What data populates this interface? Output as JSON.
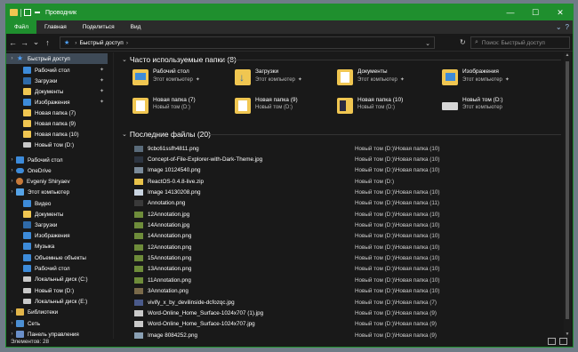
{
  "window": {
    "title": "Проводник"
  },
  "titlebar": {
    "minimize": "—",
    "maximize": "☐",
    "close": "✕"
  },
  "ribbon": {
    "tabs": [
      "Файл",
      "Главная",
      "Поделиться",
      "Вид"
    ]
  },
  "address": {
    "back": "←",
    "forward": "→",
    "recent": "⌄",
    "up": "↑",
    "path": "Быстрый доступ",
    "refresh": "↻",
    "search_placeholder": "Поиск: Быстрый доступ"
  },
  "nav": [
    {
      "label": "Быстрый доступ",
      "icon": "star-icon",
      "type": "star",
      "pinned": false,
      "selected": true
    },
    {
      "label": "Рабочий стол",
      "icon": "desktop-icon",
      "type": "blue",
      "pinned": true
    },
    {
      "label": "Загрузки",
      "icon": "downloads-icon",
      "type": "darkblue",
      "pinned": true
    },
    {
      "label": "Документы",
      "icon": "documents-icon",
      "type": "folder",
      "pinned": true
    },
    {
      "label": "Изображения",
      "icon": "pictures-icon",
      "type": "blue",
      "pinned": true
    },
    {
      "label": "Новая папка (7)",
      "icon": "folder-icon",
      "type": "folder"
    },
    {
      "label": "Новая папка (9)",
      "icon": "folder-icon",
      "type": "folder"
    },
    {
      "label": "Новая папка (10)",
      "icon": "folder-icon",
      "type": "folder"
    },
    {
      "label": "Новый том (D:)",
      "icon": "drive-icon",
      "type": "drive"
    },
    {
      "label": "Рабочий стол",
      "icon": "desktop-icon",
      "type": "blue",
      "chev": true
    },
    {
      "label": "OneDrive",
      "icon": "onedrive-icon",
      "type": "cloud"
    },
    {
      "label": "Evgeniy Shiryaev",
      "icon": "user-icon",
      "type": "user"
    },
    {
      "label": "Этот компьютер",
      "icon": "computer-icon",
      "type": "pc"
    },
    {
      "label": "Видео",
      "icon": "video-icon",
      "type": "blue"
    },
    {
      "label": "Документы",
      "icon": "documents-icon",
      "type": "folder"
    },
    {
      "label": "Загрузки",
      "icon": "downloads-icon",
      "type": "darkblue"
    },
    {
      "label": "Изображения",
      "icon": "pictures-icon",
      "type": "blue"
    },
    {
      "label": "Музыка",
      "icon": "music-icon",
      "type": "blue"
    },
    {
      "label": "Объемные объекты",
      "icon": "3d-objects-icon",
      "type": "blue"
    },
    {
      "label": "Рабочий стол",
      "icon": "desktop-icon",
      "type": "blue"
    },
    {
      "label": "Локальный диск (C:)",
      "icon": "drive-icon",
      "type": "drive"
    },
    {
      "label": "Новый том (D:)",
      "icon": "drive-icon",
      "type": "drive"
    },
    {
      "label": "Локальный диск (E:)",
      "icon": "drive-icon",
      "type": "drive"
    },
    {
      "label": "Библиотеки",
      "icon": "library-icon",
      "type": "lib"
    },
    {
      "label": "Сеть",
      "icon": "network-icon",
      "type": "net"
    },
    {
      "label": "Панель управления",
      "icon": "control-panel-icon",
      "type": "panel"
    }
  ],
  "frequent": {
    "title": "Часто используемые папки (8)",
    "items": [
      {
        "name": "Рабочий стол",
        "sub": "Этот компьютер",
        "pin": true,
        "icon": "desktop-folder-icon",
        "kind": "desk"
      },
      {
        "name": "Загрузки",
        "sub": "Этот компьютер",
        "pin": true,
        "icon": "downloads-folder-icon",
        "kind": "download"
      },
      {
        "name": "Документы",
        "sub": "Этот компьютер",
        "pin": true,
        "icon": "documents-folder-icon",
        "kind": "doc"
      },
      {
        "name": "Изображения",
        "sub": "Этот компьютер",
        "pin": true,
        "icon": "pictures-folder-icon",
        "kind": "img"
      },
      {
        "name": "Новая папка (7)",
        "sub": "Новый том (D:)",
        "pin": false,
        "icon": "folder-icon",
        "kind": "doc"
      },
      {
        "name": "Новая папка (9)",
        "sub": "Новый том (D:)",
        "pin": false,
        "icon": "folder-icon",
        "kind": "doc"
      },
      {
        "name": "Новая папка (10)",
        "sub": "Новый том (D:)",
        "pin": false,
        "icon": "folder-icon",
        "kind": "dark"
      },
      {
        "name": "Новый том (D:)",
        "sub": "Этот компьютер",
        "pin": false,
        "icon": "drive-icon",
        "kind": "drive"
      }
    ]
  },
  "recent": {
    "title": "Последние файлы (20)",
    "files": [
      {
        "name": "9cbc61ssfh4811.png",
        "location": "Новый том (D:)\\Новая папка (10)",
        "color": "#5a6b7a"
      },
      {
        "name": "Concept-of-File-Explorer-with-Dark-Theme.jpg",
        "location": "Новый том (D:)\\Новая папка (10)",
        "color": "#2c3440"
      },
      {
        "name": "Image 10124540.png",
        "location": "Новый том (D:)\\Новая папка (10)",
        "color": "#7a8a99"
      },
      {
        "name": "ReactOS-0.4.8-live.zip",
        "location": "Новый том (D:)",
        "color": "#e8c24a"
      },
      {
        "name": "Image 14130208.png",
        "location": "Новый том (D:)\\Новая папка (10)",
        "color": "#c9d4e0"
      },
      {
        "name": "Annotation.png",
        "location": "Новый том (D:)\\Новая папка (11)",
        "color": "#3a3a3a"
      },
      {
        "name": "12Annotation.jpg",
        "location": "Новый том (D:)\\Новая папка (10)",
        "color": "#6e8c3a"
      },
      {
        "name": "14Annotation.jpg",
        "location": "Новый том (D:)\\Новая папка (10)",
        "color": "#6e8c3a"
      },
      {
        "name": "14Annotation.png",
        "location": "Новый том (D:)\\Новая папка (10)",
        "color": "#6e8c3a"
      },
      {
        "name": "12Annotation.png",
        "location": "Новый том (D:)\\Новая папка (10)",
        "color": "#6e8c3a"
      },
      {
        "name": "15Annotation.png",
        "location": "Новый том (D:)\\Новая папка (10)",
        "color": "#6e8c3a"
      },
      {
        "name": "13Annotation.png",
        "location": "Новый том (D:)\\Новая папка (10)",
        "color": "#6e8c3a"
      },
      {
        "name": "11Annotation.png",
        "location": "Новый том (D:)\\Новая папка (10)",
        "color": "#6e8c3a"
      },
      {
        "name": "3Annotation.png",
        "location": "Новый том (D:)\\Новая папка (10)",
        "color": "#7a6a4a"
      },
      {
        "name": "vivify_x_by_devilinside-dcfozqc.jpg",
        "location": "Новый том (D:)\\Новая папка (7)",
        "color": "#4a5a8a"
      },
      {
        "name": "Word-Online_Home_Surface-1024x707 (1).jpg",
        "location": "Новый том (D:)\\Новая папка (9)",
        "color": "#c9c9c9"
      },
      {
        "name": "Word-Online_Home_Surface-1024x707.jpg",
        "location": "Новый том (D:)\\Новая папка (9)",
        "color": "#c9c9c9"
      },
      {
        "name": "Image 8084252.png",
        "location": "Новый том (D:)\\Новая папка (9)",
        "color": "#8aa0b4"
      }
    ]
  },
  "status": {
    "items": "Элементов: 28"
  }
}
